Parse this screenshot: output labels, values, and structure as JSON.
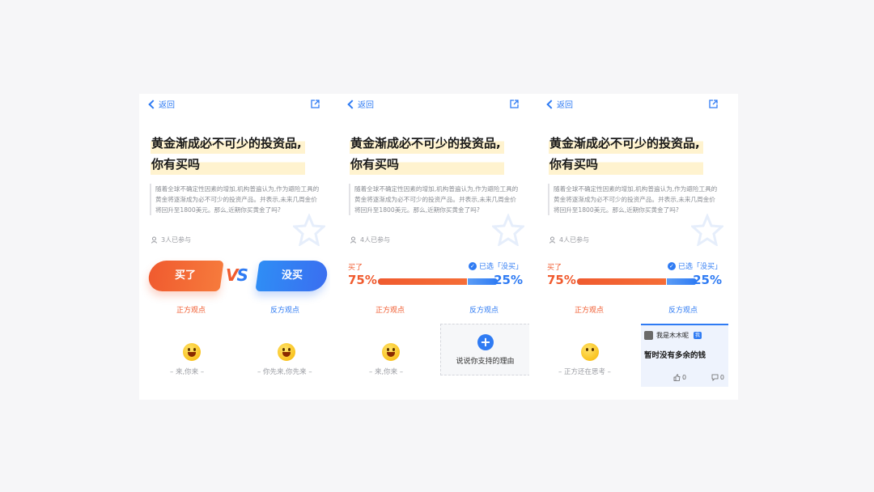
{
  "panels": [
    {
      "back_label": "返回",
      "title_line1": "黄金渐成必不可少的投资品,",
      "title_line2": "你有买吗",
      "description": "随着全球不确定性因素的增加,机构普遍认为,作为避险工具的黄金将逐渐成为必不可少的投资产品。并表示,未来几周金价将回升至1800美元。那么,近期你买黄金了吗?",
      "participants": "3人已参与",
      "buy_button": "买了",
      "no_button": "没买",
      "vs_v": "V",
      "vs_s": "S",
      "pro_label": "正方观点",
      "con_label": "反方观点",
      "pro_caption": "– 来,你来 –",
      "con_caption": "– 你先来,你先来 –"
    },
    {
      "back_label": "返回",
      "title_line1": "黄金渐成必不可少的投资品,",
      "title_line2": "你有买吗",
      "description": "随着全球不确定性因素的增加,机构普遍认为,作为避险工具的黄金将逐渐成为必不可少的投资产品。并表示,未来几周金价将回升至1800美元。那么,近期你买黄金了吗?",
      "participants": "4人已参与",
      "buy_label": "买了",
      "selected": "已选「没买」",
      "pct_buy": "75%",
      "pct_no": "25%",
      "buy_share": 0.75,
      "pro_label": "正方观点",
      "con_label": "反方观点",
      "pro_caption": "– 来,你来 –",
      "add_reason": "说说你支持的理由"
    },
    {
      "back_label": "返回",
      "title_line1": "黄金渐成必不可少的投资品,",
      "title_line2": "你有买吗",
      "description": "随着全球不确定性因素的增加,机构普遍认为,作为避险工具的黄金将逐渐成为必不可少的投资产品。并表示,未来几周金价将回升至1800美元。那么,近期你买黄金了吗?",
      "participants": "4人已参与",
      "buy_label": "买了",
      "selected": "已选「没买」",
      "pct_buy": "75%",
      "pct_no": "25%",
      "buy_share": 0.75,
      "pro_label": "正方观点",
      "con_label": "反方观点",
      "pro_caption": "– 正方还在思考 –",
      "comment": {
        "user": "我是木木呢",
        "badge": "我",
        "text": "暂时没有多余的钱",
        "likes": "0",
        "replies": "0"
      }
    }
  ],
  "colors": {
    "buy": "#f05b2f",
    "no": "#2f7bf3"
  },
  "icons": {
    "back": "chevron-left-icon",
    "share": "share-icon",
    "people": "people-icon",
    "add": "plus-icon",
    "like": "thumbs-up-icon",
    "reply": "reply-icon"
  }
}
